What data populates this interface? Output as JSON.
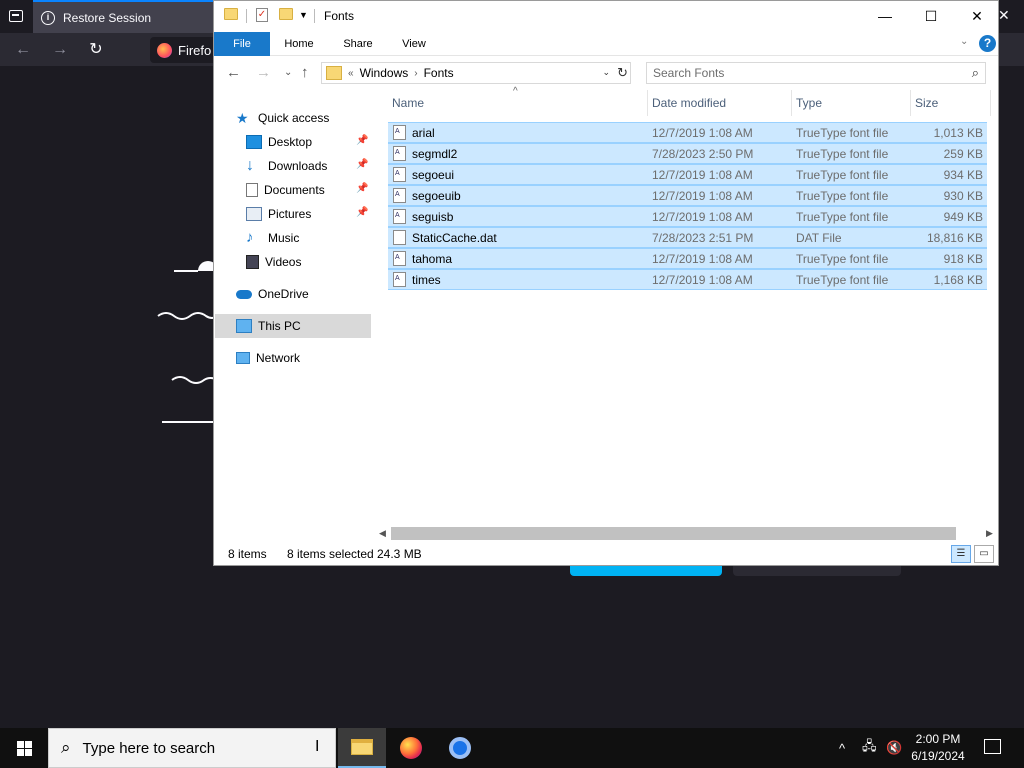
{
  "firefox": {
    "tab_title": "Restore Session",
    "url_text": "Firefo"
  },
  "explorer": {
    "title": "Fonts",
    "ribbon": [
      "File",
      "Home",
      "Share",
      "View"
    ],
    "help": "?",
    "address": {
      "overflow": "«",
      "crumbs": [
        "Windows",
        "Fonts"
      ]
    },
    "search_placeholder": "Search Fonts",
    "nav": [
      {
        "label": "Quick access",
        "icon": "star-icon"
      },
      {
        "label": "Desktop",
        "icon": "desktop-icon",
        "pinned": true
      },
      {
        "label": "Downloads",
        "icon": "downloads-icon",
        "pinned": true
      },
      {
        "label": "Documents",
        "icon": "documents-icon",
        "pinned": true
      },
      {
        "label": "Pictures",
        "icon": "pictures-icon",
        "pinned": true
      },
      {
        "label": "Music",
        "icon": "music-icon"
      },
      {
        "label": "Videos",
        "icon": "videos-icon"
      },
      {
        "label": "OneDrive",
        "icon": "cloud-icon"
      },
      {
        "label": "This PC",
        "icon": "pc-icon",
        "selected": true
      },
      {
        "label": "Network",
        "icon": "network-icon"
      }
    ],
    "columns": [
      "Name",
      "Date modified",
      "Type",
      "Size"
    ],
    "files": [
      {
        "name": "arial",
        "date": "12/7/2019 1:08 AM",
        "type": "TrueType font file",
        "size": "1,013 KB"
      },
      {
        "name": "segmdl2",
        "date": "7/28/2023 2:50 PM",
        "type": "TrueType font file",
        "size": "259 KB"
      },
      {
        "name": "segoeui",
        "date": "12/7/2019 1:08 AM",
        "type": "TrueType font file",
        "size": "934 KB"
      },
      {
        "name": "segoeuib",
        "date": "12/7/2019 1:08 AM",
        "type": "TrueType font file",
        "size": "930 KB"
      },
      {
        "name": "seguisb",
        "date": "12/7/2019 1:08 AM",
        "type": "TrueType font file",
        "size": "949 KB"
      },
      {
        "name": "StaticCache.dat",
        "date": "7/28/2023 2:51 PM",
        "type": "DAT File",
        "size": "18,816 KB"
      },
      {
        "name": "tahoma",
        "date": "12/7/2019 1:08 AM",
        "type": "TrueType font file",
        "size": "918 KB"
      },
      {
        "name": "times",
        "date": "12/7/2019 1:08 AM",
        "type": "TrueType font file",
        "size": "1,168 KB"
      }
    ],
    "status": {
      "count": "8 items",
      "selected": "8 items selected",
      "size": "24.3 MB"
    }
  },
  "taskbar": {
    "search_placeholder": "Type here to search",
    "time": "2:00 PM",
    "date": "6/19/2024"
  }
}
